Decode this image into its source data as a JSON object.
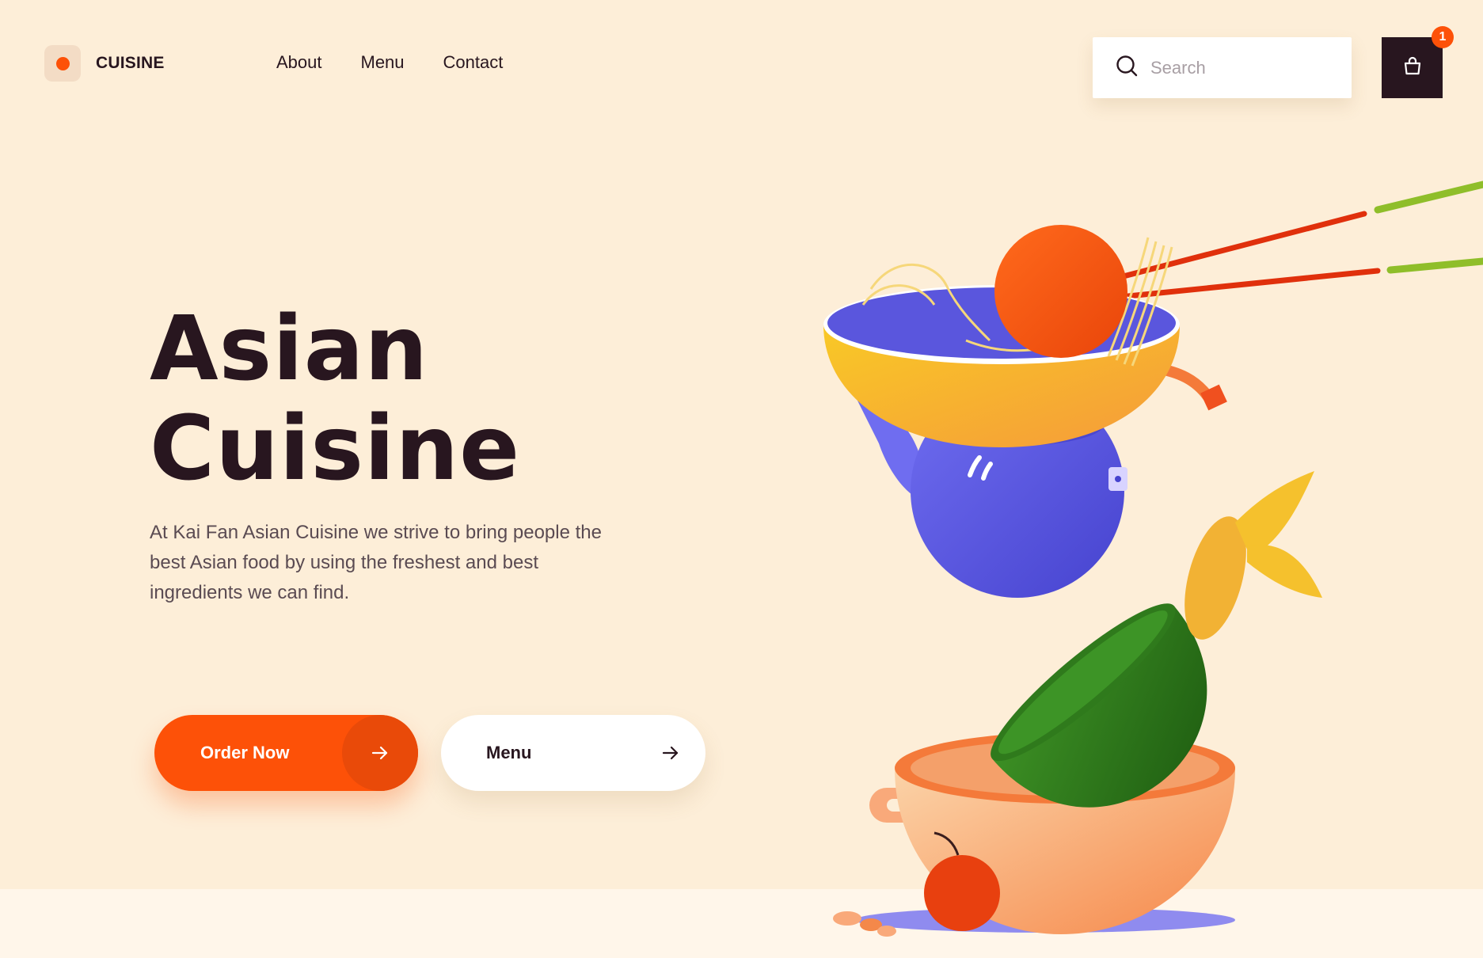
{
  "brand": {
    "name": "CUISINE",
    "accent_color": "#fd5108",
    "dark_color": "#28161f",
    "background_color": "#fdeed8"
  },
  "nav": {
    "items": [
      {
        "label": "About"
      },
      {
        "label": "Menu"
      },
      {
        "label": "Contact"
      }
    ]
  },
  "search": {
    "placeholder": "Search",
    "value": ""
  },
  "cart": {
    "count": "1"
  },
  "hero": {
    "title_line1": "Asian",
    "title_line2": "Cuisine",
    "description": "At Kai Fan Asian Cuisine we strive to bring people the best Asian food by using the freshest and  best ingredients we can find.",
    "primary_button": "Order Now",
    "secondary_button": "Menu"
  },
  "illustration": {
    "icons": [
      "chopsticks",
      "orange-ball",
      "noodles",
      "yellow-bowl",
      "blue-teapot",
      "green-bowl",
      "corn",
      "orange-pot",
      "cherry-tomato"
    ],
    "colors": {
      "orange": "#fd5108",
      "yellow": "#f5b52e",
      "blue": "#5a56dd",
      "green": "#2f7a1c",
      "peach": "#f9a97a"
    }
  }
}
